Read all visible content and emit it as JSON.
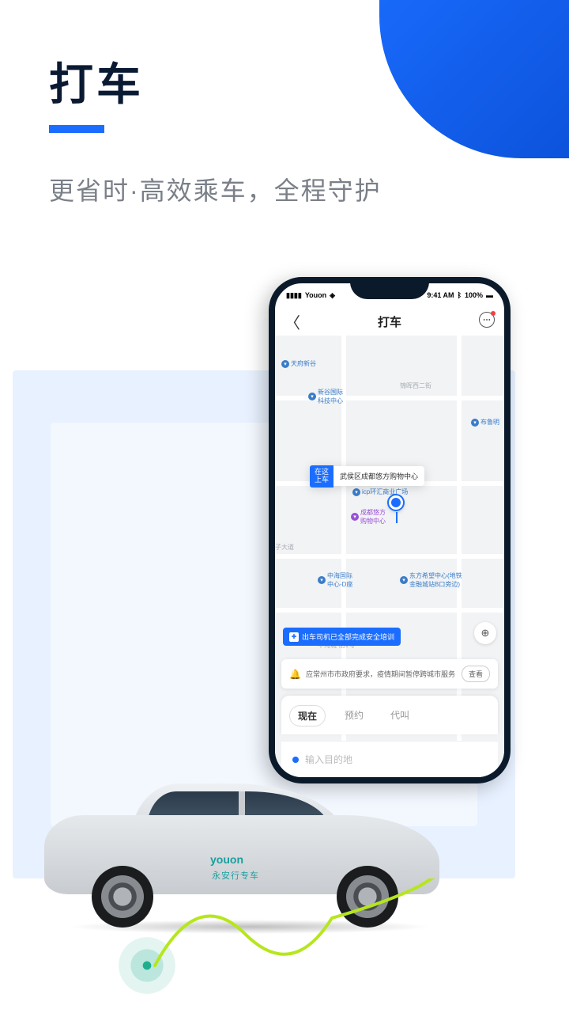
{
  "headline": "打车",
  "subhead": "更省时·高效乘车，全程守护",
  "phone": {
    "status": {
      "carrier": "Youon",
      "time": "9:41 AM",
      "bt": "100%"
    },
    "nav_title": "打车",
    "pickup_tag": "在这\n上车",
    "pickup_location": "武侯区成都悠方购物中心",
    "pois": {
      "tianfu": "天府新谷",
      "xingu": "新谷国际\n科技中心",
      "jinhui_rd": "锦晖西二街",
      "bulu": "布鲁明",
      "icp": "icp环汇商业广场",
      "youfang": "成都悠方\n购物中心",
      "zidadao": "子大道",
      "zhonghai": "中海国际\n中心-D座",
      "dongfang": "东方希望中心(地铁\n金融城站B口旁边)",
      "zhonghaicheng": "中海城-南1号"
    },
    "safety_banner": "出车司机已全部完成安全培训",
    "notice_text": "应常州市市政府要求，疫情期间暂停跨城市服务",
    "notice_btn": "查看",
    "tabs": {
      "now": "现在",
      "reserve": "预约",
      "proxy": "代叫"
    },
    "dest_placeholder": "输入目的地"
  },
  "car": {
    "brand": "youon",
    "brand_sub": "永安行专车"
  }
}
